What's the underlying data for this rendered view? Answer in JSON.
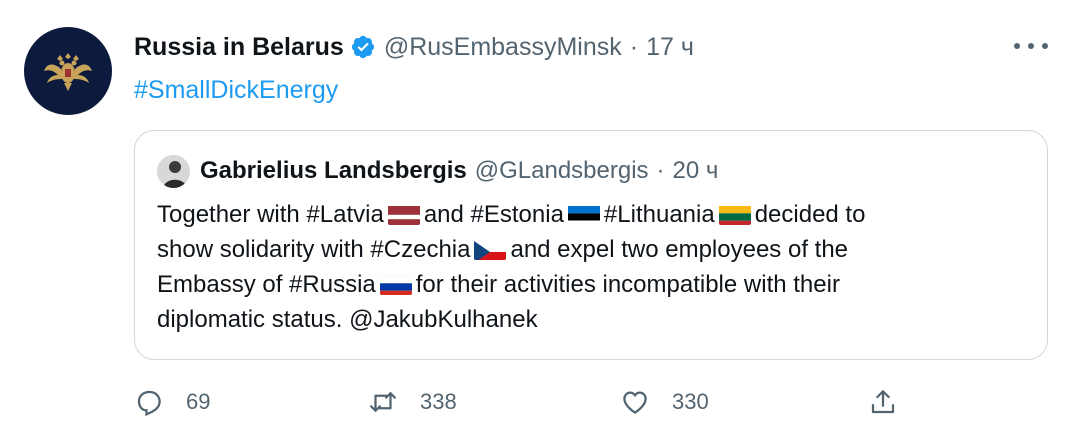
{
  "tweet": {
    "author_name": "Russia in Belarus",
    "author_handle": "@RusEmbassyMinsk",
    "separator": "·",
    "time": "17 ч",
    "text": "#SmallDickEnergy",
    "avatar_icon": "russian-coat-of-arms-icon",
    "verified_icon": "verified-badge-icon",
    "more_icon": "more-options-icon"
  },
  "quote": {
    "author_name": "Gabrielius Landsbergis",
    "author_handle": "@GLandsbergis",
    "separator": "·",
    "time": "20 ч",
    "lines": [
      {
        "a": "Together with #Latvia",
        "b": "and #Estonia",
        "c": "#Lithuania",
        "d": "decided to"
      },
      {
        "a": "show solidarity with #Czechia",
        "b": "and expel two employees of the"
      },
      {
        "a": "Embassy of #Russia",
        "b": "for their activities incompatible with their"
      },
      {
        "a": "diplomatic status. @JakubKulhanek"
      }
    ],
    "flags": [
      "latvia-flag-icon",
      "estonia-flag-icon",
      "lithuania-flag-icon",
      "czechia-flag-icon",
      "russia-flag-icon"
    ]
  },
  "actions": {
    "reply_count": "69",
    "retweet_count": "338",
    "like_count": "330",
    "reply_icon": "reply-icon",
    "retweet_icon": "retweet-icon",
    "like_icon": "heart-icon",
    "share_icon": "share-icon"
  },
  "colors": {
    "accent": "#1d9bf0",
    "secondary_text": "#536471",
    "border": "#cfd9de"
  }
}
